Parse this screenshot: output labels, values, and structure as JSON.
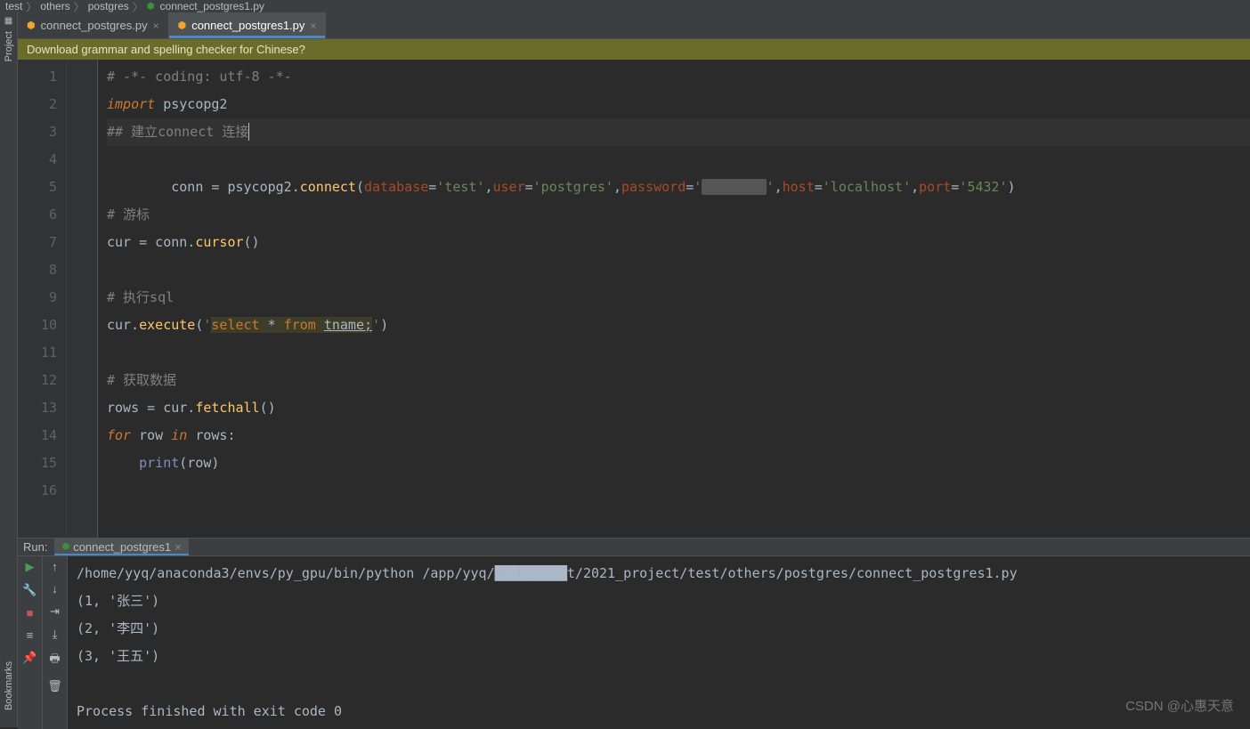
{
  "breadcrumb": {
    "items": [
      "test",
      "others",
      "postgres",
      "connect_postgres1.py"
    ]
  },
  "left_tools": {
    "project": "Project",
    "bookmarks": "Bookmarks"
  },
  "tabs": [
    {
      "label": "connect_postgres.py",
      "active": false
    },
    {
      "label": "connect_postgres1.py",
      "active": true
    }
  ],
  "banner": "Download grammar and spelling checker for Chinese?",
  "code": {
    "line_count": 16,
    "lines": {
      "l1_comment": "# -*- coding: utf-8 -*-",
      "l2_import": "import",
      "l2_mod": " psycopg2",
      "l3_comment": "## 建立connect 连接",
      "l4_a": "conn ",
      "l4_eq": "=",
      "l4_b": " psycopg2.",
      "l4_connect": "connect",
      "l4_p_open": "(",
      "l4_kw_database": "database",
      "l4_eq2": "=",
      "l4_v_database": "'test'",
      "l4_sep": ",",
      "l4_kw_user": "user",
      "l4_v_user": "'postgres'",
      "l4_kw_password": "password",
      "l4_v_password_open": "'",
      "l4_v_password_mask": "        ",
      "l4_v_password_end": "'",
      "l4_kw_host": "host",
      "l4_v_host": "'localhost'",
      "l4_kw_port": "port",
      "l4_v_port": "'5432'",
      "l4_p_close": ")",
      "l6_comment": "# 游标",
      "l7_a": "cur ",
      "l7_b": " conn.",
      "l7_cursor": "cursor",
      "l7_par": "()",
      "l9_comment": "# 执行sql",
      "l10_a": "cur.",
      "l10_execute": "execute",
      "l10_open": "(",
      "l10_q": "'",
      "l10_sql_select": "select",
      "l10_sql_star": " * ",
      "l10_sql_from": "from",
      "l10_sql_sp": " ",
      "l10_sql_tname": "tname;",
      "l10_close": ")",
      "l12_comment": "# 获取数据",
      "l13_a": "rows ",
      "l13_b": " cur.",
      "l13_fetchall": "fetchall",
      "l13_par": "()",
      "l14_for": "for",
      "l14_row": " row ",
      "l14_in": "in",
      "l14_rows": " rows",
      "l14_colon": ":",
      "l15_indent": "    ",
      "l15_print": "print",
      "l15_arg": "(row)"
    }
  },
  "run": {
    "label": "Run:",
    "tab": "connect_postgres1",
    "output": [
      "/home/yyq/anaconda3/envs/py_gpu/bin/python /app/yyq/█████████t/2021_project/test/others/postgres/connect_postgres1.py",
      "(1, '张三')",
      "(2, '李四')",
      "(3, '王五')",
      "",
      "Process finished with exit code 0"
    ]
  },
  "watermark": "CSDN @心惠天意"
}
